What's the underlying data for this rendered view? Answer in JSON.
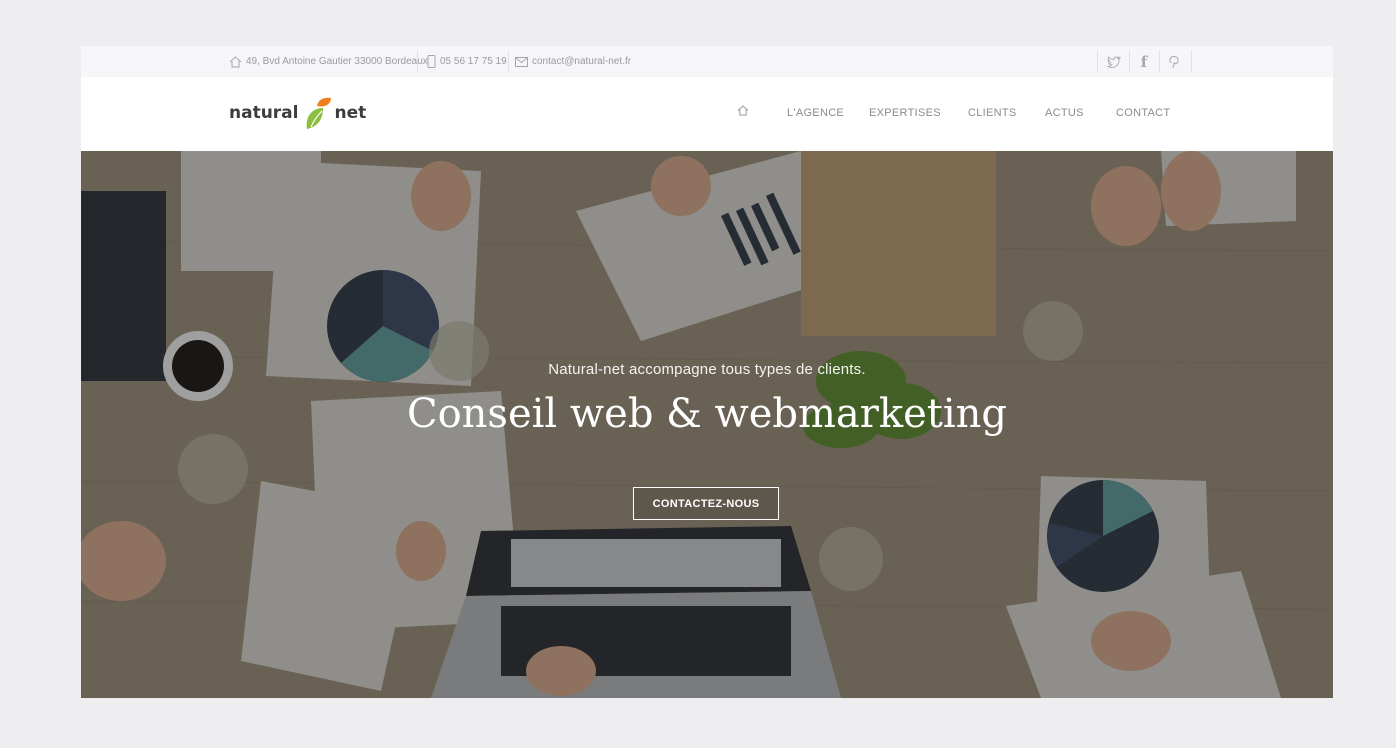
{
  "topbar": {
    "address": "49, Bvd Antoine Gautier 33000 Bordeaux",
    "phone": "05 56 17 75 19",
    "email": "contact@natural-net.fr",
    "social": [
      "twitter-icon",
      "facebook-icon",
      "pinterest-icon"
    ]
  },
  "logo": {
    "left": "natural",
    "right": "net",
    "colors": {
      "leaf_green": "#8cbf3f",
      "leaf_orange": "#f07d1e"
    }
  },
  "nav": {
    "home_icon": "home-icon",
    "items": [
      "L'AGENCE",
      "EXPERTISES",
      "CLIENTS",
      "ACTUS",
      "CONTACT"
    ]
  },
  "hero": {
    "subtitle": "Natural-net accompagne tous types de clients.",
    "title": "Conseil web & webmarketing",
    "button": "CONTACTEZ-NOUS"
  }
}
